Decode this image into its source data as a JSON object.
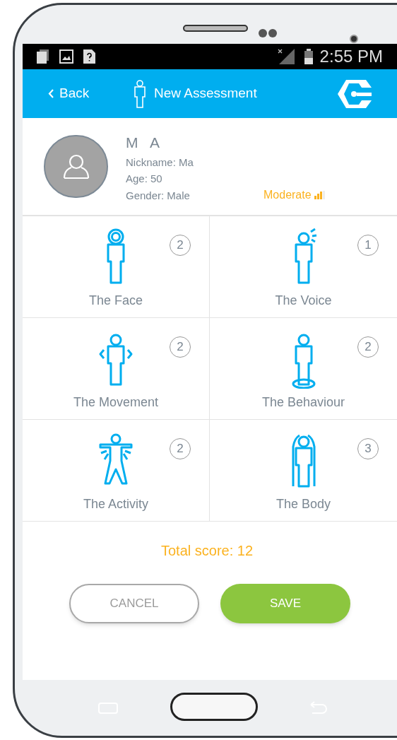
{
  "status_bar": {
    "time": "2:55 PM"
  },
  "header": {
    "back": "Back",
    "title": "New Assessment"
  },
  "profile": {
    "name": "M  A",
    "nickname": "Nickname: Ma",
    "age": "Age: 50",
    "gender": "Gender: Male",
    "severity": "Moderate"
  },
  "categories": [
    {
      "kind": "face",
      "label": "The Face",
      "score": "2"
    },
    {
      "kind": "voice",
      "label": "The Voice",
      "score": "1"
    },
    {
      "kind": "movement",
      "label": "The Movement",
      "score": "2"
    },
    {
      "kind": "behaviour",
      "label": "The Behaviour",
      "score": "2"
    },
    {
      "kind": "activity",
      "label": "The Activity",
      "score": "2"
    },
    {
      "kind": "body",
      "label": "The Body",
      "score": "3"
    }
  ],
  "total": "Total score: 12",
  "buttons": {
    "cancel": "CANCEL",
    "save": "SAVE"
  }
}
